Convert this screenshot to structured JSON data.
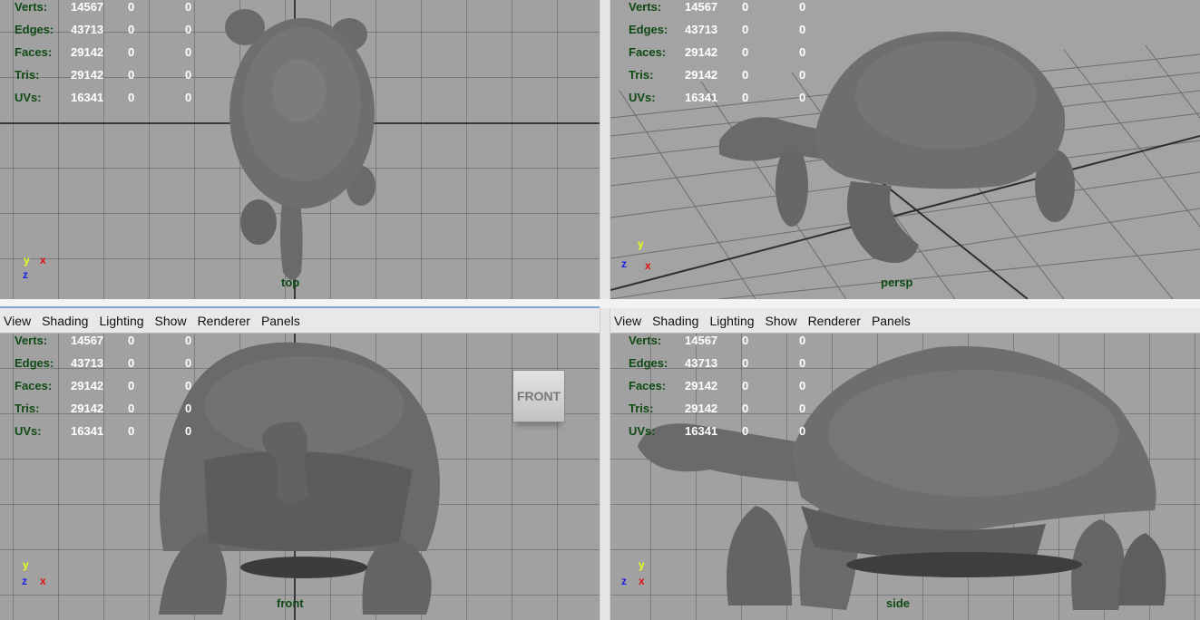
{
  "hud": {
    "rows": [
      {
        "label": "Verts:",
        "value": "14567",
        "sel": "0",
        "comp": "0"
      },
      {
        "label": "Edges:",
        "value": "43713",
        "sel": "0",
        "comp": "0"
      },
      {
        "label": "Faces:",
        "value": "29142",
        "sel": "0",
        "comp": "0"
      },
      {
        "label": "Tris:",
        "value": "29142",
        "sel": "0",
        "comp": "0"
      },
      {
        "label": "UVs:",
        "value": "16341",
        "sel": "0",
        "comp": "0"
      }
    ]
  },
  "viewports": {
    "top": {
      "camera": "top"
    },
    "persp": {
      "camera": "persp"
    },
    "front": {
      "camera": "front",
      "viewcube": "FRONT"
    },
    "side": {
      "camera": "side"
    }
  },
  "menu": [
    "View",
    "Shading",
    "Lighting",
    "Show",
    "Renderer",
    "Panels"
  ],
  "axes": {
    "x": "x",
    "y": "y",
    "z": "z"
  },
  "colors": {
    "viewport_bg": "#a1a1a1",
    "hud_label": "#0f4a14",
    "hud_value": "#ffffff",
    "model": "#6b6b6b",
    "selected_panel": "#7ea6cf"
  }
}
